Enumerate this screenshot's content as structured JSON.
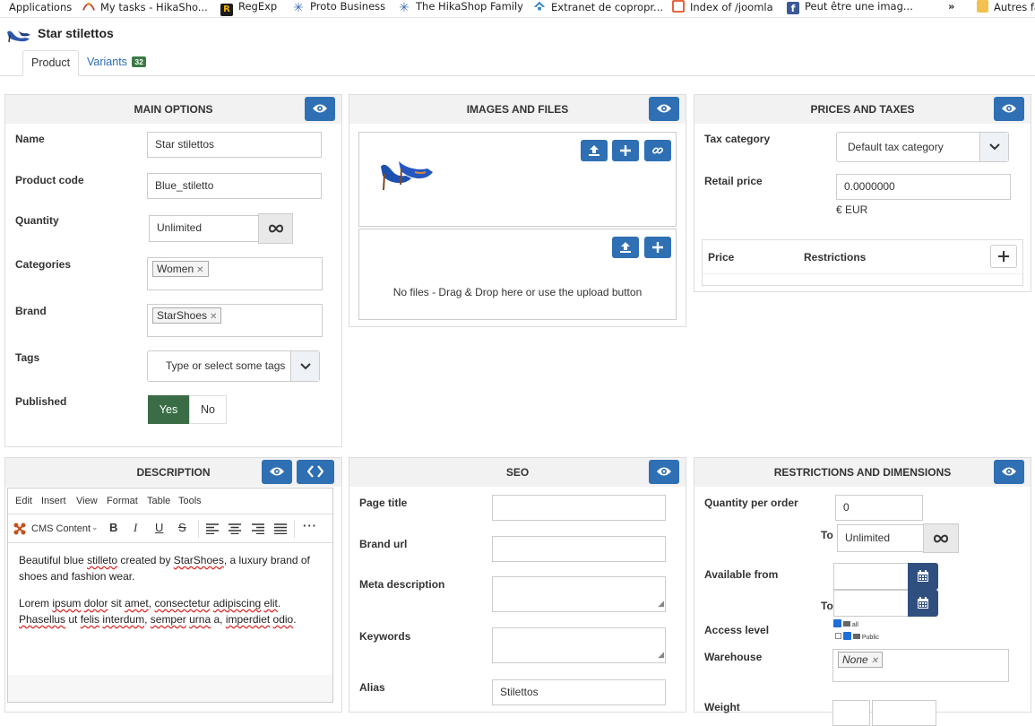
{
  "bookmarks": [
    {
      "label": "Applications",
      "icon": "apps-grid-icon",
      "color": "#e0a020"
    },
    {
      "label": "My tasks - HikaSho...",
      "icon": "asana-icon",
      "color": "#f06a6a"
    },
    {
      "label": "RegExp",
      "icon": "regexp-r-icon",
      "color": "#1b1b1b"
    },
    {
      "label": "Proto Business",
      "icon": "snowflake-icon",
      "color": "#3a6db0"
    },
    {
      "label": "The HikaShop Family",
      "icon": "snowflake-icon",
      "color": "#3a6db0"
    },
    {
      "label": "Extranet de copropr...",
      "icon": "house-icon",
      "color": "#2a7fc0"
    },
    {
      "label": "Index of /joomla",
      "icon": "joomla-icon",
      "color": "#e8643c"
    },
    {
      "label": "Peut être une imag...",
      "icon": "facebook-icon",
      "color": "#3b5998"
    },
    {
      "label": "»",
      "icon": "",
      "color": ""
    },
    {
      "label": "Autres fa",
      "icon": "folder-icon",
      "color": "#f2c14e"
    }
  ],
  "product": {
    "title": "Star stilettos"
  },
  "tabs": {
    "product": "Product",
    "variants": "Variants",
    "variants_count": "32"
  },
  "main_options": {
    "header": "MAIN OPTIONS",
    "name_label": "Name",
    "name_value": "Star stilettos",
    "code_label": "Product code",
    "code_value": "Blue_stiletto",
    "quantity_label": "Quantity",
    "quantity_value": "Unlimited",
    "categories_label": "Categories",
    "categories_chip": "Women",
    "brand_label": "Brand",
    "brand_chip": "StarShoes",
    "tags_label": "Tags",
    "tags_placeholder": "Type or select some tags",
    "published_label": "Published",
    "yes": "Yes",
    "no": "No"
  },
  "images": {
    "header": "IMAGES AND FILES",
    "no_files": "No files - Drag & Drop here or use the upload button"
  },
  "prices": {
    "header": "PRICES AND TAXES",
    "tax_label": "Tax category",
    "tax_value": "Default tax category",
    "retail_label": "Retail price",
    "retail_value": "0.0000000",
    "currency": "€ EUR",
    "col_price": "Price",
    "col_restrictions": "Restrictions"
  },
  "description": {
    "header": "DESCRIPTION",
    "menu": [
      "Edit",
      "Insert",
      "View",
      "Format",
      "Table",
      "Tools"
    ],
    "cms_content": "CMS Content",
    "para1_parts": [
      "Beautiful blue ",
      "stilleto",
      " created by ",
      "StarShoes",
      ", a luxury brand of shoes and fashion wear."
    ],
    "para2_parts": [
      "Lorem ",
      "ipsum",
      " ",
      "dolor",
      " sit ",
      "amet",
      ", ",
      "consectetur",
      " ",
      "adipiscing",
      " ",
      "elit",
      ". ",
      "Phasellus",
      " ut ",
      "felis",
      " ",
      "interdum",
      ", ",
      "semper",
      " ",
      "urna",
      " a, ",
      "imperdiet",
      " ",
      "odio",
      "."
    ]
  },
  "seo": {
    "header": "SEO",
    "page_title": "Page title",
    "brand_url": "Brand url",
    "meta_description": "Meta description",
    "keywords": "Keywords",
    "alias": "Alias",
    "alias_value": "Stilettos"
  },
  "restrictions": {
    "header": "RESTRICTIONS AND DIMENSIONS",
    "qty_label": "Quantity per order",
    "qty_min": "0",
    "to": "To",
    "qty_max": "Unlimited",
    "available_label": "Available from",
    "access_label": "Access level",
    "access_all": "all",
    "access_public": "Public",
    "warehouse_label": "Warehouse",
    "warehouse_chip": "None",
    "weight_label": "Weight"
  },
  "colors": {
    "primary_button": "#2f6fb3",
    "yes_active": "#3a6d45",
    "badge": "#3c7a44"
  }
}
